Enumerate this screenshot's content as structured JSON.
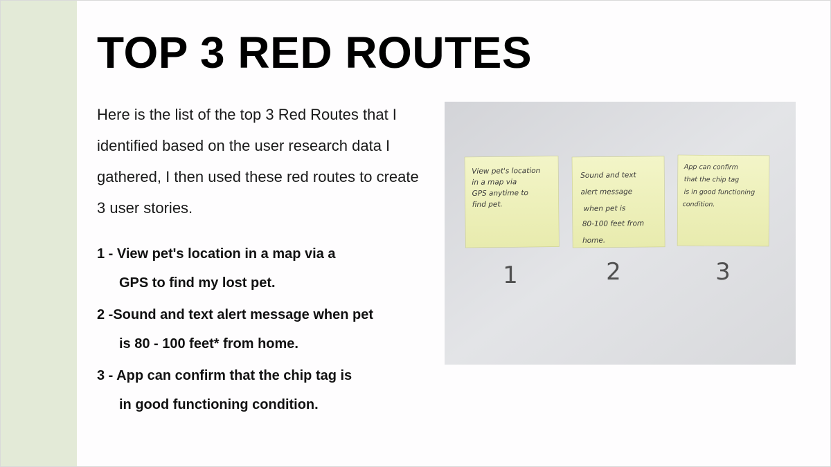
{
  "slide": {
    "title": "TOP 3 RED ROUTES",
    "intro": "Here is the list of the top 3 Red Routes that I identified based on the user research data I gathered, I then used these red routes to create 3 user stories.",
    "routes": [
      {
        "line1": "1 - View pet's location in a map via a",
        "line2": "GPS to find my lost pet."
      },
      {
        "line1": "2 -Sound and text alert message when pet",
        "line2": "is 80 - 100 feet* from home."
      },
      {
        "line1": "3 - App can confirm that the chip tag is",
        "line2": "in good functioning condition."
      }
    ]
  },
  "photo": {
    "notes": [
      {
        "number": "1",
        "lines": [
          "View pet's location",
          "in a map via",
          "GPS anytime to",
          "find pet."
        ]
      },
      {
        "number": "2",
        "lines": [
          "Sound and text",
          "alert message",
          "when pet is",
          "80-100 feet from",
          "home."
        ]
      },
      {
        "number": "3",
        "lines": [
          "App can confirm",
          "that the chip tag",
          "is in good functioning",
          "condition."
        ]
      }
    ],
    "colors": {
      "sticky": "#f1f3bf",
      "whiteboard": "#dcdde0",
      "ink": "#333333"
    }
  }
}
